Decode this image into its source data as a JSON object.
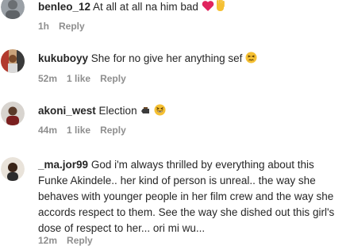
{
  "comments": [
    {
      "username": "benleo_12",
      "text": "At all at all na him bad",
      "emojis": [
        "heart-icon",
        "waving-hand-icon"
      ],
      "time": "1h",
      "likes": "",
      "reply": "Reply"
    },
    {
      "username": "kukuboyy",
      "text": "She for no give her anything sef",
      "emojis": [
        "persevering-face-icon"
      ],
      "time": "52m",
      "likes": "1 like",
      "reply": "Reply"
    },
    {
      "username": "akoni_west",
      "text": "Election",
      "emojis": [
        "coffin-icon",
        "grinning-squinting-face-icon"
      ],
      "time": "44m",
      "likes": "1 like",
      "reply": "Reply"
    },
    {
      "username": "_ma.jor99",
      "text": "God i'm always thrilled by everything about this Funke Akindele.. her kind of person is unreal.. the way she behaves with younger people in her film crew and the way she accords respect to them. See the way she dished out this girl's dose of respect to her... ori mi wu...",
      "emojis": [],
      "time": "12m",
      "likes": "",
      "reply": "Reply"
    }
  ],
  "colors": {
    "text": "#262626",
    "meta": "#8e8e8e",
    "heart": "#e0245e",
    "hand": "#f5c033",
    "face": "#f5c033"
  }
}
